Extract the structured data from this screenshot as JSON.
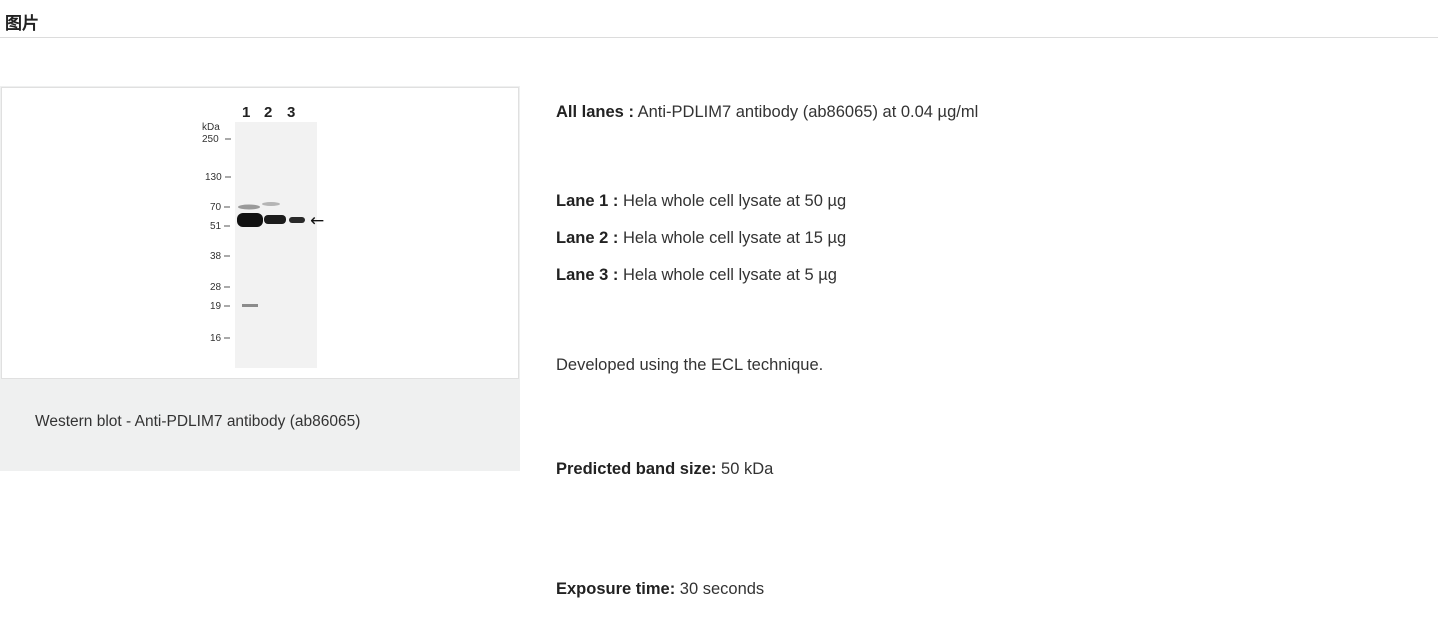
{
  "section": {
    "title": "图片"
  },
  "figure": {
    "caption": "Western blot - Anti-PDLIM7 antibody (ab86065)",
    "blot": {
      "lane_numbers": [
        "1",
        "2",
        "3"
      ],
      "unit_label": "kDa",
      "markers": [
        "250",
        "130",
        "70",
        "51",
        "38",
        "28",
        "19",
        "16"
      ],
      "band_arrow": "←"
    }
  },
  "details": {
    "all_lanes": {
      "label": "All lanes :",
      "value": " Anti-PDLIM7 antibody (ab86065) at 0.04 µg/ml"
    },
    "lanes": [
      {
        "label": "Lane 1 :",
        "value": " Hela whole cell lysate at 50 µg"
      },
      {
        "label": "Lane 2 :",
        "value": " Hela whole cell lysate at 15 µg"
      },
      {
        "label": "Lane 3 :",
        "value": " Hela whole cell lysate at 5 µg"
      }
    ],
    "technique": "Developed using the ECL technique.",
    "band_size": {
      "label": "Predicted band size:",
      "value": " 50 kDa"
    },
    "exposure": {
      "label": "Exposure time:",
      "value": " 30 seconds"
    }
  }
}
